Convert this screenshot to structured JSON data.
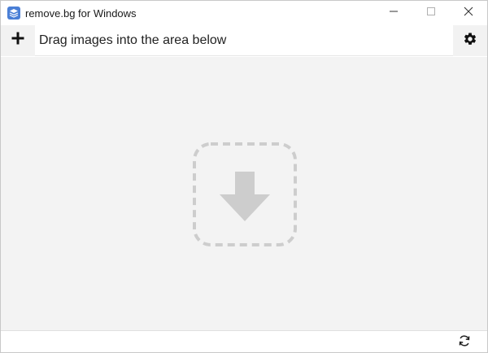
{
  "window": {
    "title": "remove.bg for Windows",
    "controls": {
      "minimize_icon": "minimize-icon",
      "maximize_icon": "maximize-icon",
      "close_icon": "close-icon"
    }
  },
  "toolbar": {
    "add_icon": "plus-icon",
    "instruction": "Drag images into the area below",
    "settings_icon": "gear-icon"
  },
  "drop_area": {
    "icon": "download-arrow-icon"
  },
  "statusbar": {
    "refresh_icon": "refresh-icon"
  },
  "colors": {
    "app_icon": "#4a7fd6",
    "drop_background": "#f3f3f3",
    "drop_icon": "#cdcdcd",
    "text": "#222222"
  }
}
